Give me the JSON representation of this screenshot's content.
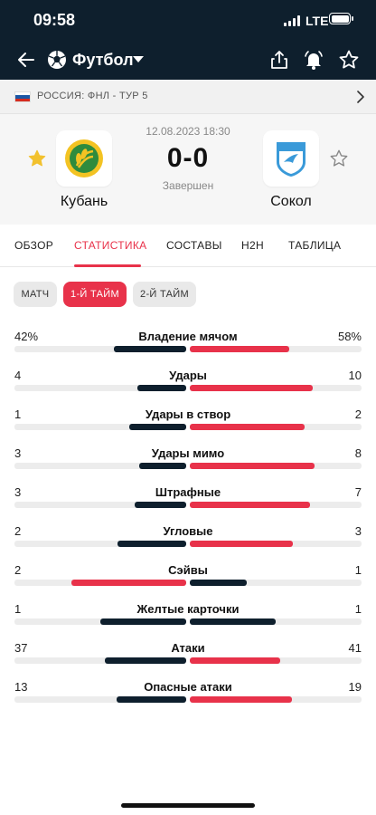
{
  "status_bar": {
    "time": "09:58",
    "network": "LTE"
  },
  "nav": {
    "title": "Футбол"
  },
  "league": {
    "text": "РОССИЯ: ФНЛ - ТУР 5"
  },
  "match": {
    "date": "12.08.2023 18:30",
    "score": "0-0",
    "status": "Завершен",
    "home": {
      "name": "Кубань",
      "favorite": true
    },
    "away": {
      "name": "Сокол",
      "favorite": false
    }
  },
  "tabs": [
    {
      "label": "ОБЗОР",
      "active": false
    },
    {
      "label": "СТАТИСТИКА",
      "active": true
    },
    {
      "label": "СОСТАВЫ",
      "active": false
    },
    {
      "label": "H2H",
      "active": false
    },
    {
      "label": "ТАБЛИЦА",
      "active": false
    }
  ],
  "periods": [
    {
      "label": "МАТЧ",
      "active": false
    },
    {
      "label": "1-Й ТАЙМ",
      "active": true
    },
    {
      "label": "2-Й ТАЙМ",
      "active": false
    }
  ],
  "colors": {
    "header": "#0e1f2d",
    "accent": "#e8324a",
    "home_bar": "#0e1f2d",
    "away_bar": "#e8324a"
  },
  "stats": [
    {
      "name": "Владение мячом",
      "home": "42%",
      "away": "58%",
      "home_val": 42,
      "away_val": 58
    },
    {
      "name": "Удары",
      "home": "4",
      "away": "10",
      "home_val": 4,
      "away_val": 10
    },
    {
      "name": "Удары в створ",
      "home": "1",
      "away": "2",
      "home_val": 1,
      "away_val": 2
    },
    {
      "name": "Удары мимо",
      "home": "3",
      "away": "8",
      "home_val": 3,
      "away_val": 8
    },
    {
      "name": "Штрафные",
      "home": "3",
      "away": "7",
      "home_val": 3,
      "away_val": 7
    },
    {
      "name": "Угловые",
      "home": "2",
      "away": "3",
      "home_val": 2,
      "away_val": 3
    },
    {
      "name": "Сэйвы",
      "home": "2",
      "away": "1",
      "home_val": 2,
      "away_val": 1
    },
    {
      "name": "Желтые карточки",
      "home": "1",
      "away": "1",
      "home_val": 1,
      "away_val": 1
    },
    {
      "name": "Атаки",
      "home": "37",
      "away": "41",
      "home_val": 37,
      "away_val": 41
    },
    {
      "name": "Опасные атаки",
      "home": "13",
      "away": "19",
      "home_val": 13,
      "away_val": 19
    }
  ]
}
